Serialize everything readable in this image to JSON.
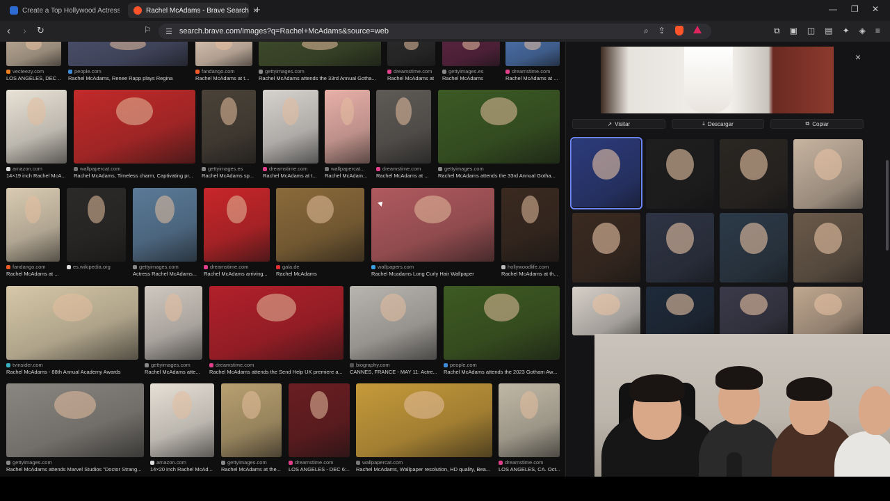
{
  "browser": {
    "tabs": [
      {
        "title": "Create a Top Hollywood Actress Tier",
        "active": false,
        "icon": "tiermaker-favicon"
      },
      {
        "title": "Rachel McAdams - Brave Search",
        "active": true,
        "icon": "brave-favicon"
      }
    ],
    "url": "search.brave.com/images?q=Rachel+McAdams&source=web",
    "new_tab_label": "+",
    "close_symbol": "×"
  },
  "results": [
    {
      "source": "vecteezy.com",
      "caption": "LOS ANGELES, DEC ...",
      "color": "#b9a894"
    },
    {
      "source": "people.com",
      "caption": "Rachel McAdams, Renee Rapp plays Regina",
      "color": "#4a4f6a"
    },
    {
      "source": "fandango.com",
      "caption": "Rachel McAdams at t...",
      "color": "#d8c2b0"
    },
    {
      "source": "gettyimages.com",
      "caption": "Rachel McAdams attends the 33rd Annual Gotha...",
      "color": "#3d4a2a"
    },
    {
      "source": "dreamstime.com",
      "caption": "Rachel McAdams at ...",
      "color": "#2a2a2a"
    },
    {
      "source": "gettyimages.es",
      "caption": "Rachel McAdams",
      "color": "#5a2440"
    },
    {
      "source": "dreamstime.com",
      "caption": "Rachel McAdams at ...",
      "color": "#4a6fa8"
    },
    {
      "source": "amazon.com",
      "caption": "14×19 inch Rachel McA...",
      "color": "#e8e2d6"
    },
    {
      "source": "wallpapercat.com",
      "caption": "Rachel McAdams, Timeless charm, Captivating pr...",
      "color": "#c22a2a"
    },
    {
      "source": "gettyimages.es",
      "caption": "Rachel McAdams sp...",
      "color": "#4a4238"
    },
    {
      "source": "dreamstime.com",
      "caption": "Rachel McAdams at t...",
      "color": "#d6d2ce"
    },
    {
      "source": "wallpapercat...",
      "caption": "Rachel McAdam...",
      "color": "#e8b0a8"
    },
    {
      "source": "dreamstime.com",
      "caption": "Rachel McAdams at ...",
      "color": "#5e5a56"
    },
    {
      "source": "gettyimages.com",
      "caption": "Rachel McAdams attends the 33rd Annual Gotha...",
      "color": "#3c5a24"
    },
    {
      "source": "fandango.com",
      "caption": "Rachel McAdams at ...",
      "color": "#d9cbb2"
    },
    {
      "source": "es.wikipedia.org",
      "caption": "",
      "color": "#2c2a28"
    },
    {
      "source": "gettyimages.com",
      "caption": "Actress Rachel McAdams...",
      "color": "#5a7a98"
    },
    {
      "source": "dreamstime.com",
      "caption": "Rachel McAdams arriving...",
      "color": "#c8262a"
    },
    {
      "source": "gala.de",
      "caption": "Rachel McAdams",
      "color": "#8a6a3a"
    },
    {
      "source": "wallpapers.com",
      "caption": "Rachel Mcadams Long Curly Hair Wallpaper",
      "color": "#b05a5e"
    },
    {
      "source": "hollywoodlife.com",
      "caption": "Rachel McAdams at th...",
      "color": "#3a2a20"
    },
    {
      "source": "tvinsider.com",
      "caption": "Rachel McAdams - 88th Annual Academy Awards",
      "color": "#d6c8a8"
    },
    {
      "source": "gettyimages.com",
      "caption": "Rachel McAdams atte...",
      "color": "#cfc8c0"
    },
    {
      "source": "dreamstime.com",
      "caption": "Rachel McAdams attends the Send Help UK premiere a...",
      "color": "#b2202a"
    },
    {
      "source": "biography.com",
      "caption": "CANNES, FRANCE - MAY 11: Actre...",
      "color": "#b8b4ae"
    },
    {
      "source": "people.com",
      "caption": "Rachel McAdams attends the 2023 Gotham Aw...",
      "color": "#3e5a22"
    },
    {
      "source": "gettyimages.com",
      "caption": "Rachel McAdams attends Marvel Studios \"Doctor Strang...",
      "color": "#8a8680"
    },
    {
      "source": "amazon.com",
      "caption": "14×20 inch Rachel McAd...",
      "color": "#e6e0d6"
    },
    {
      "source": "gettyimages.com",
      "caption": "Rachel McAdams at the...",
      "color": "#b8a070"
    },
    {
      "source": "dreamstime.com",
      "caption": "LOS ANGELES - DEC 6:...",
      "color": "#6a1e22"
    },
    {
      "source": "wallpapercat.com",
      "caption": "Rachel McAdams, Wallpaper resolution, HD quality, Bea...",
      "color": "#c69a3a"
    },
    {
      "source": "dreamstime.com",
      "caption": "LOS ANGELES, CA. Oct...",
      "color": "#c0b8a6"
    }
  ],
  "panel": {
    "close": "×",
    "actions": [
      {
        "label": "Visitar",
        "icon": "external-link-icon"
      },
      {
        "label": "Descargar",
        "icon": "download-icon"
      },
      {
        "label": "Copiar",
        "icon": "copy-icon"
      }
    ],
    "related_colors": [
      "#2b3a7a",
      "#1e1e1e",
      "#2a2622",
      "#c7b4a0",
      "#3a2a20",
      "#2e3444",
      "#2c3a48",
      "#6a5a4a",
      "#d6d0c8",
      "#1e2a3a",
      "#3a3a4a",
      "#c0a890"
    ]
  }
}
